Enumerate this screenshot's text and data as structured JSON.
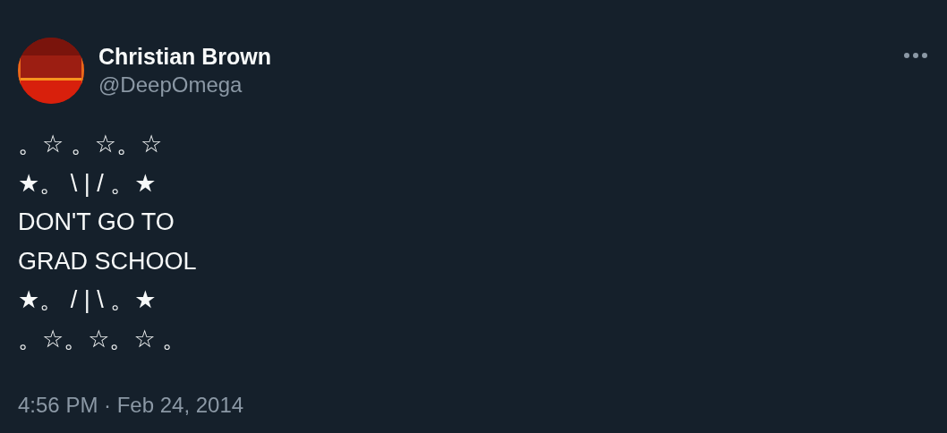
{
  "author": {
    "name": "Christian Brown",
    "handle": "@DeepOmega"
  },
  "tweet": {
    "lines": [
      "。☆ 。☆。☆",
      "★。 \\ | / 。★",
      "DON'T GO TO",
      "GRAD SCHOOL",
      "★。 / | \\ 。★",
      "。☆。☆。☆ 。"
    ]
  },
  "timestamp": "4:56 PM · Feb 24, 2014"
}
